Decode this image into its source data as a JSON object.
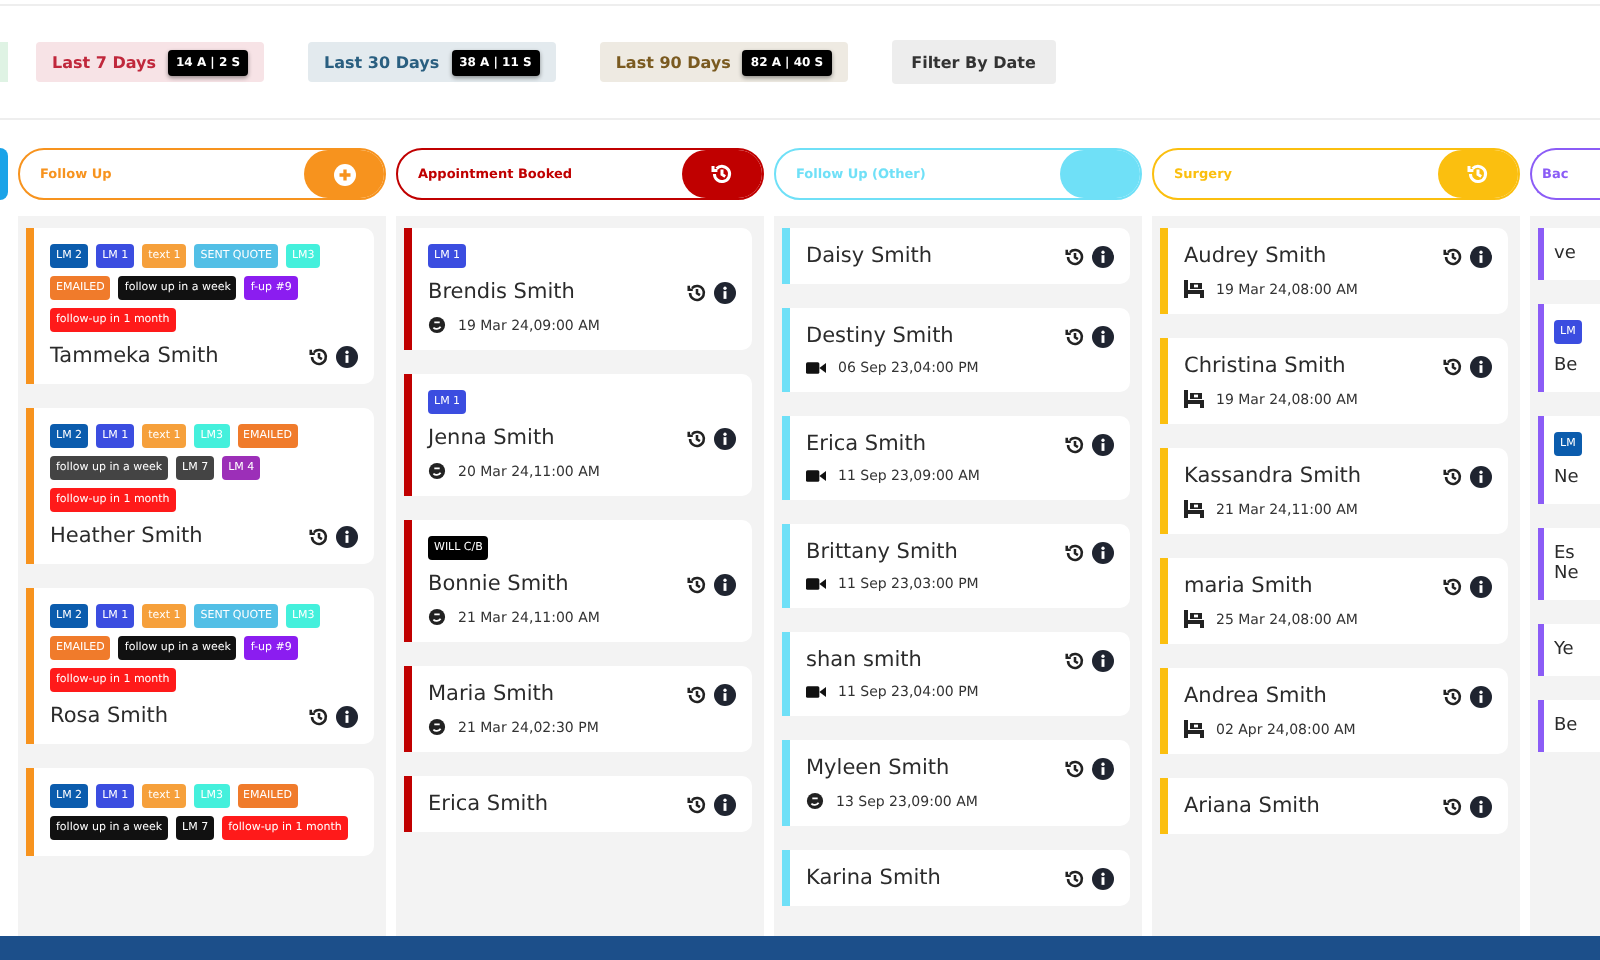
{
  "filters": [
    {
      "label": "Last 7 Days",
      "count": "14 A | 2 S",
      "color": "#c0283c"
    },
    {
      "label": "Last 30 Days",
      "count": "38 A | 11 S",
      "color": "#2a5f80"
    },
    {
      "label": "Last 90 Days",
      "count": "82 A | 40 S",
      "color": "#7a5a20"
    },
    {
      "label": "Filter By Date",
      "color": "#333333"
    }
  ],
  "columns": [
    {
      "title": "Follow Up",
      "color": "#f7931e",
      "kind": "add",
      "cards": [
        {
          "tags": [
            {
              "text": "LM 2",
              "color": "#0b5cad"
            },
            {
              "text": "LM 1",
              "color": "#3b4de0"
            },
            {
              "text": "text 1",
              "color": "#f6a03b"
            },
            {
              "text": "SENT QUOTE",
              "color": "#52bfe6"
            },
            {
              "text": "LM3",
              "color": "#44f0dc"
            },
            {
              "text": "EMAILED",
              "color": "#f07b2b"
            },
            {
              "text": "follow up in a week",
              "color": "#111111"
            },
            {
              "text": "f-up #9",
              "color": "#8b1df0"
            },
            {
              "text": "follow-up in 1 month",
              "color": "#ff1a1a"
            }
          ],
          "name": "Tammeka Smith"
        },
        {
          "tags": [
            {
              "text": "LM 2",
              "color": "#0b5cad"
            },
            {
              "text": "LM 1",
              "color": "#3b4de0"
            },
            {
              "text": "text 1",
              "color": "#f6a03b"
            },
            {
              "text": "LM3",
              "color": "#44f0dc"
            },
            {
              "text": "EMAILED",
              "color": "#f07b2b"
            },
            {
              "text": "follow up in a week",
              "color": "#444444"
            },
            {
              "text": "LM 7",
              "color": "#444444"
            },
            {
              "text": "LM 4",
              "color": "#9c2fb8"
            },
            {
              "text": "follow-up in 1 month",
              "color": "#ff1a1a"
            }
          ],
          "name": "Heather Smith"
        },
        {
          "tags": [
            {
              "text": "LM 2",
              "color": "#0b5cad"
            },
            {
              "text": "LM 1",
              "color": "#3b4de0"
            },
            {
              "text": "text 1",
              "color": "#f6a03b"
            },
            {
              "text": "SENT QUOTE",
              "color": "#52bfe6"
            },
            {
              "text": "LM3",
              "color": "#44f0dc"
            },
            {
              "text": "EMAILED",
              "color": "#f07b2b"
            },
            {
              "text": "follow up in a week",
              "color": "#111111"
            },
            {
              "text": "f-up #9",
              "color": "#8b1df0"
            },
            {
              "text": "follow-up in 1 month",
              "color": "#ff1a1a"
            }
          ],
          "name": "Rosa Smith"
        },
        {
          "tags": [
            {
              "text": "LM 2",
              "color": "#0b5cad"
            },
            {
              "text": "LM 1",
              "color": "#3b4de0"
            },
            {
              "text": "text 1",
              "color": "#f6a03b"
            },
            {
              "text": "LM3",
              "color": "#44f0dc"
            },
            {
              "text": "EMAILED",
              "color": "#f07b2b"
            },
            {
              "text": "follow up in a week",
              "color": "#111111"
            },
            {
              "text": "LM 7",
              "color": "#111111"
            },
            {
              "text": "follow-up in 1 month",
              "color": "#ff1a1a"
            }
          ]
        }
      ]
    },
    {
      "title": "Appointment Booked",
      "color": "#c00000",
      "kind": "history",
      "cards": [
        {
          "tags": [
            {
              "text": "LM 1",
              "color": "#3b4de0"
            }
          ],
          "name": "Brendis Smith",
          "date": "19 Mar 24,09:00 AM",
          "kind": "chat"
        },
        {
          "tags": [
            {
              "text": "LM 1",
              "color": "#3b4de0"
            }
          ],
          "name": "Jenna Smith",
          "date": "20 Mar 24,11:00 AM",
          "kind": "chat"
        },
        {
          "tags": [
            {
              "text": "WILL C/B",
              "color": "#000000"
            }
          ],
          "name": "Bonnie Smith",
          "date": "21 Mar 24,11:00 AM",
          "kind": "chat"
        },
        {
          "name": "Maria Smith",
          "date": "21 Mar 24,02:30 PM",
          "kind": "chat"
        },
        {
          "name": "Erica Smith"
        }
      ]
    },
    {
      "title": "Follow Up (Other)",
      "color": "#6fe0f7",
      "kind": "plain",
      "cards": [
        {
          "name": "Daisy Smith"
        },
        {
          "name": "Destiny Smith",
          "date": "06 Sep 23,04:00 PM",
          "kind": "video"
        },
        {
          "name": "Erica Smith",
          "date": "11 Sep 23,09:00 AM",
          "kind": "video"
        },
        {
          "name": "Brittany Smith",
          "date": "11 Sep 23,03:00 PM",
          "kind": "video"
        },
        {
          "name": "shan smith",
          "date": "11 Sep 23,04:00 PM",
          "kind": "video"
        },
        {
          "name": "Myleen Smith",
          "date": "13 Sep 23,09:00 AM",
          "kind": "chat"
        },
        {
          "name": "Karina Smith"
        }
      ]
    },
    {
      "title": "Surgery",
      "color": "#fbbf0f",
      "kind": "history",
      "cards": [
        {
          "name": "Audrey Smith",
          "date": "19 Mar 24,08:00 AM",
          "kind": "surgery"
        },
        {
          "name": "Christina Smith",
          "date": "19 Mar 24,08:00 AM",
          "kind": "surgery"
        },
        {
          "name": "Kassandra Smith",
          "date": "21 Mar 24,11:00 AM",
          "kind": "surgery"
        },
        {
          "name": "maria Smith",
          "date": "25 Mar 24,08:00 AM",
          "kind": "surgery"
        },
        {
          "name": "Andrea Smith",
          "date": "02 Apr 24,08:00 AM",
          "kind": "surgery"
        },
        {
          "name": "Ariana Smith"
        }
      ]
    },
    {
      "title": "Bac",
      "color": "#8b5cf6",
      "kind": "plain",
      "cards": [
        {
          "name": "ve"
        },
        {
          "tags": [
            {
              "text": "LM",
              "color": "#3b4de0"
            }
          ],
          "name": "Be"
        },
        {
          "tags": [
            {
              "text": "LM",
              "color": "#0b5cad"
            }
          ],
          "name": "Ne"
        },
        {
          "name": "Es Ne"
        },
        {
          "name": "Ye"
        },
        {
          "name": "Be"
        }
      ]
    }
  ]
}
